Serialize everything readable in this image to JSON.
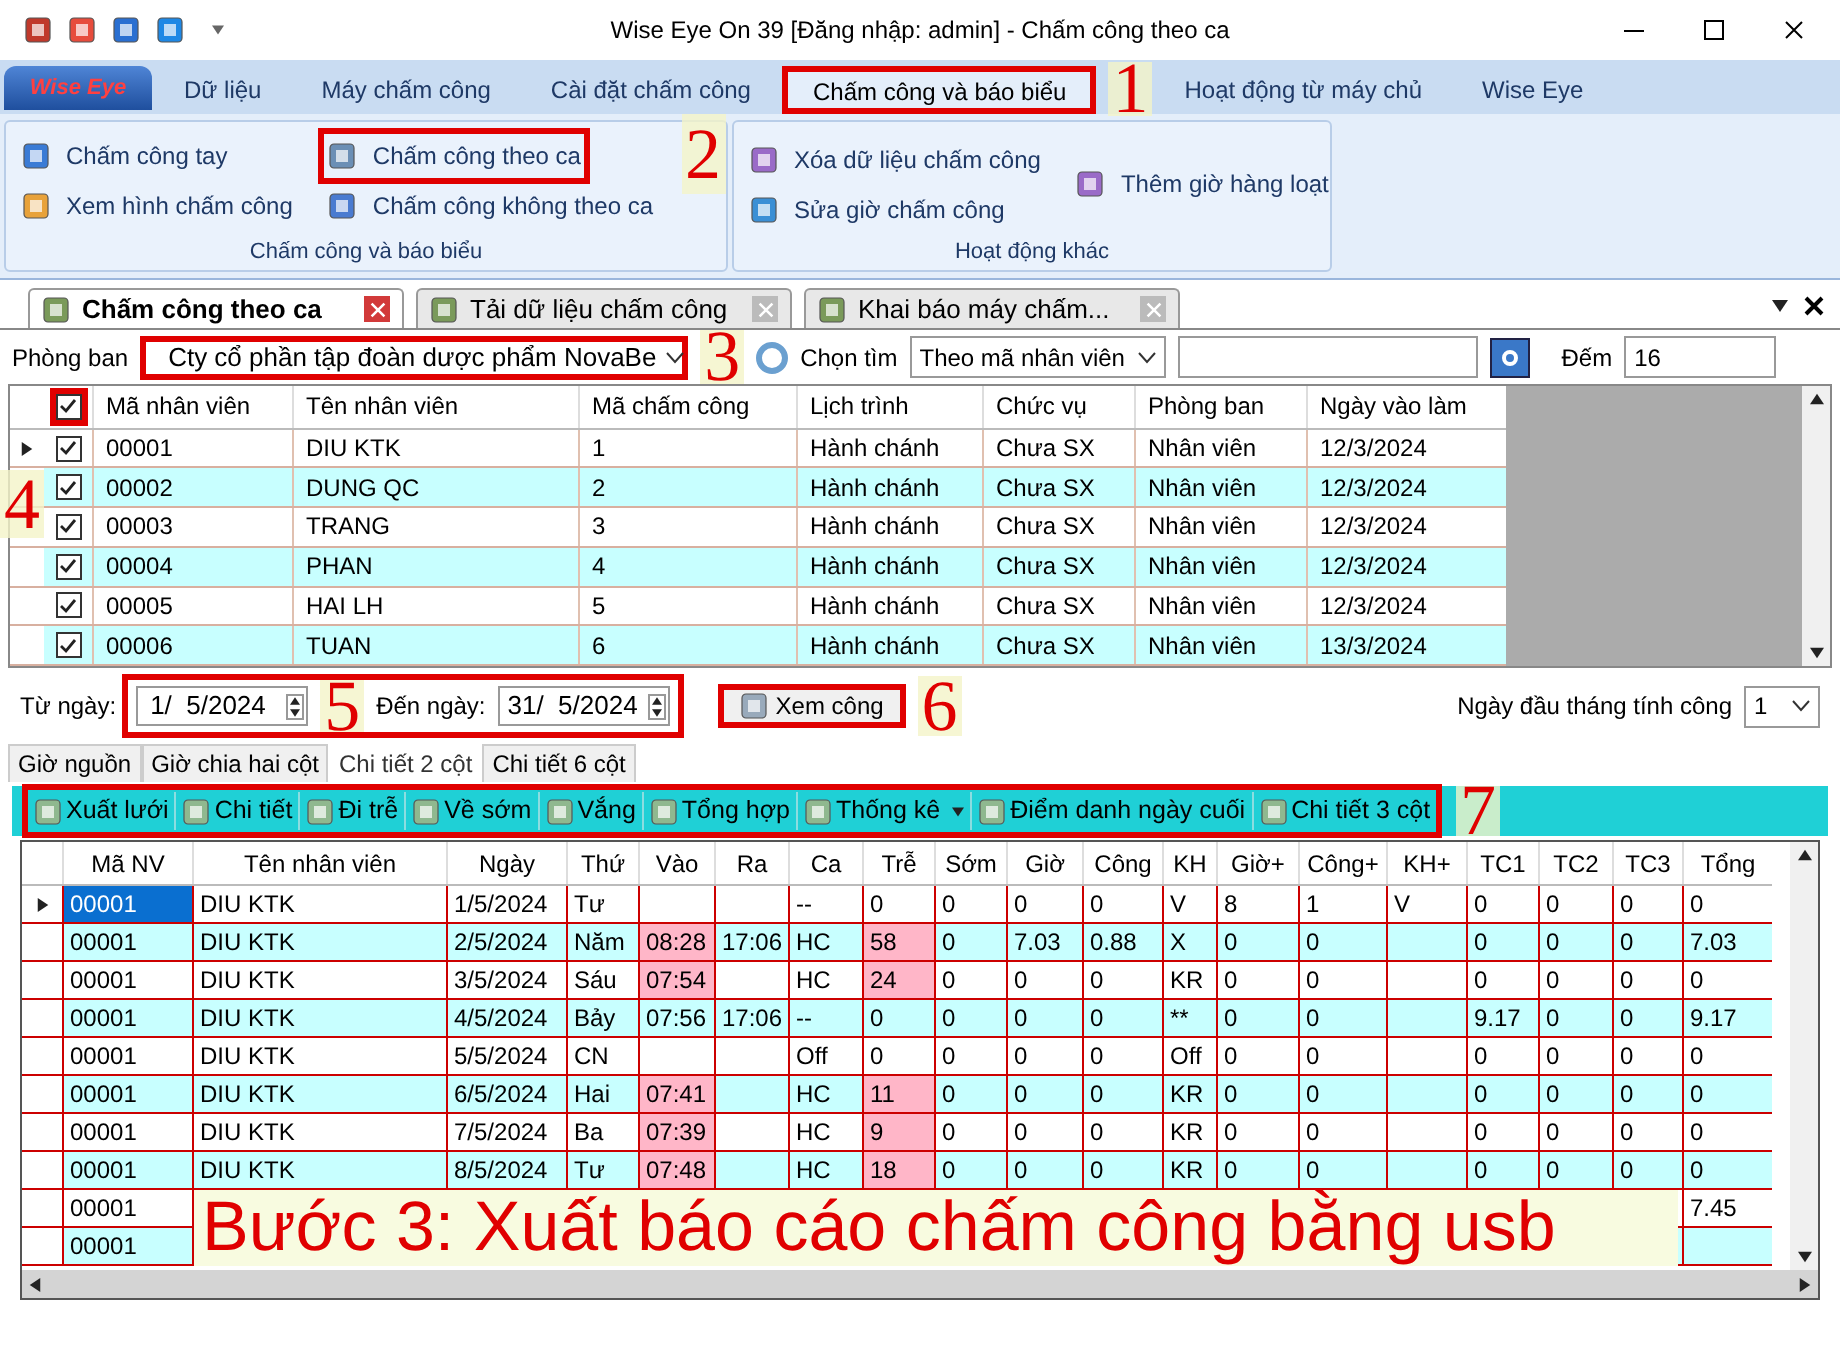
{
  "window": {
    "title": "Wise Eye On 39 [Đăng nhập: admin] - Chấm công theo ca"
  },
  "ribbon": {
    "app_button": "Wise Eye",
    "tabs": [
      {
        "label": "Dữ liệu",
        "selected": false,
        "highlighted": false
      },
      {
        "label": "Máy chấm công",
        "selected": false,
        "highlighted": false
      },
      {
        "label": "Cài đặt chấm công",
        "selected": false,
        "highlighted": false
      },
      {
        "label": "Chấm công và báo biểu",
        "selected": true,
        "highlighted": true,
        "callout": "1"
      },
      {
        "label": "Hoạt động từ máy chủ",
        "selected": false,
        "highlighted": false
      },
      {
        "label": "Wise Eye",
        "selected": false,
        "highlighted": false
      }
    ],
    "groups": [
      {
        "title": "Chấm công và báo biểu",
        "items": [
          {
            "label": "Chấm công tay",
            "highlighted": false
          },
          {
            "label": "Xem hình chấm công",
            "highlighted": false
          },
          {
            "label": "Chấm công theo ca",
            "highlighted": true,
            "callout": "2"
          },
          {
            "label": "Chấm công không theo ca",
            "highlighted": false
          }
        ]
      },
      {
        "title": "Hoạt động khác",
        "items": [
          {
            "label": "Xóa dữ liệu chấm công",
            "highlighted": false
          },
          {
            "label": "Sửa giờ chấm công",
            "highlighted": false
          },
          {
            "label": "Thêm giờ hàng loạt",
            "highlighted": false
          }
        ]
      }
    ]
  },
  "doc_tabs": [
    {
      "label": "Chấm công theo ca",
      "selected": true
    },
    {
      "label": "Tải dữ liệu chấm công",
      "selected": false
    },
    {
      "label": "Khai báo máy chấm...",
      "selected": false
    }
  ],
  "filter": {
    "department_label": "Phòng ban",
    "department": "Cty cổ phần tập đoàn dược phẩm NovaBe",
    "department_highlighted": true,
    "department_callout": "3",
    "search_label": "Chọn tìm",
    "search_mode": "Theo mã nhân viên",
    "count_label": "Đếm",
    "count": "16"
  },
  "employees": {
    "all_checked": true,
    "header_callout": "4",
    "columns": [
      "Mã nhân viên",
      "Tên nhân viên",
      "Mã chấm công",
      "Lịch trình",
      "Chức vụ",
      "Phòng ban",
      "Ngày vào làm"
    ],
    "rows": [
      {
        "checked": true,
        "current": true,
        "cells": [
          "00001",
          "DIU KTK",
          "1",
          "Hành chánh",
          "Chưa SX",
          "Nhân viên",
          "12/3/2024"
        ]
      },
      {
        "checked": true,
        "current": false,
        "cells": [
          "00002",
          "DUNG QC",
          "2",
          "Hành chánh",
          "Chưa SX",
          "Nhân viên",
          "12/3/2024"
        ]
      },
      {
        "checked": true,
        "current": false,
        "cells": [
          "00003",
          "TRANG",
          "3",
          "Hành chánh",
          "Chưa SX",
          "Nhân viên",
          "12/3/2024"
        ]
      },
      {
        "checked": true,
        "current": false,
        "cells": [
          "00004",
          "PHAN",
          "4",
          "Hành chánh",
          "Chưa SX",
          "Nhân viên",
          "12/3/2024"
        ]
      },
      {
        "checked": true,
        "current": false,
        "cells": [
          "00005",
          "HAI LH",
          "5",
          "Hành chánh",
          "Chưa SX",
          "Nhân viên",
          "12/3/2024"
        ]
      },
      {
        "checked": true,
        "current": false,
        "cells": [
          "00006",
          "TUAN",
          "6",
          "Hành chánh",
          "Chưa SX",
          "Nhân viên",
          "13/3/2024"
        ]
      }
    ]
  },
  "date_range": {
    "from_label": "Từ ngày:",
    "from": "1/  5/2024",
    "to_label": "Đến ngày:",
    "to": "31/  5/2024",
    "callout": "5",
    "view_button": "Xem công",
    "view_callout": "6",
    "month_start_label": "Ngày đầu tháng tính công",
    "month_start": "1"
  },
  "sub_tabs": [
    {
      "label": "Giờ nguồn",
      "selected": false
    },
    {
      "label": "Giờ chia hai cột",
      "selected": false
    },
    {
      "label": "Chi tiết 2 cột",
      "selected": true
    },
    {
      "label": "Chi tiết 6 cột",
      "selected": false
    }
  ],
  "toolbar": {
    "callout": "7",
    "items": [
      {
        "label": "Xuất lưới",
        "kind": "button"
      },
      {
        "label": "Chi tiết",
        "kind": "button"
      },
      {
        "label": "Đi trễ",
        "kind": "button"
      },
      {
        "label": "Về sớm",
        "kind": "button"
      },
      {
        "label": "Vắng",
        "kind": "button"
      },
      {
        "label": "Tổng hợp",
        "kind": "button"
      },
      {
        "label": "Thống kê",
        "kind": "dropdown"
      },
      {
        "label": "Điểm danh ngày cuối",
        "kind": "button"
      },
      {
        "label": "Chi tiết 3 cột",
        "kind": "button"
      }
    ]
  },
  "attendance": {
    "columns": [
      "Mã NV",
      "Tên nhân viên",
      "Ngày",
      "Thứ",
      "Vào",
      "Ra",
      "Ca",
      "Trễ",
      "Sớm",
      "Giờ",
      "Công",
      "KH",
      "Giờ+",
      "Công+",
      "KH+",
      "TC1",
      "TC2",
      "TC3",
      "Tổng"
    ],
    "rows": [
      {
        "current": true,
        "late": false,
        "cells": [
          "00001",
          "DIU KTK",
          "1/5/2024",
          "Tư",
          null,
          null,
          "--",
          "0",
          "0",
          "0",
          "0",
          "V",
          "8",
          "1",
          "V",
          "0",
          "0",
          "0",
          "0"
        ]
      },
      {
        "current": false,
        "late": true,
        "cells": [
          "00001",
          "DIU KTK",
          "2/5/2024",
          "Năm",
          "08:28",
          "17:06",
          "HC",
          "58",
          "0",
          "7.03",
          "0.88",
          "X",
          "0",
          "0",
          null,
          "0",
          "0",
          "0",
          "7.03"
        ]
      },
      {
        "current": false,
        "late": true,
        "cells": [
          "00001",
          "DIU KTK",
          "3/5/2024",
          "Sáu",
          "07:54",
          null,
          "HC",
          "24",
          "0",
          "0",
          "0",
          "KR",
          "0",
          "0",
          null,
          "0",
          "0",
          "0",
          "0"
        ]
      },
      {
        "current": false,
        "late": false,
        "cells": [
          "00001",
          "DIU KTK",
          "4/5/2024",
          "Bảy",
          "07:56",
          "17:06",
          "--",
          "0",
          "0",
          "0",
          "0",
          "**",
          "0",
          "0",
          null,
          "9.17",
          "0",
          "0",
          "9.17"
        ]
      },
      {
        "current": false,
        "late": false,
        "cells": [
          "00001",
          "DIU KTK",
          "5/5/2024",
          "CN",
          null,
          null,
          "Off",
          "0",
          "0",
          "0",
          "0",
          "Off",
          "0",
          "0",
          null,
          "0",
          "0",
          "0",
          "0"
        ]
      },
      {
        "current": false,
        "late": true,
        "cells": [
          "00001",
          "DIU KTK",
          "6/5/2024",
          "Hai",
          "07:41",
          null,
          "HC",
          "11",
          "0",
          "0",
          "0",
          "KR",
          "0",
          "0",
          null,
          "0",
          "0",
          "0",
          "0"
        ]
      },
      {
        "current": false,
        "late": true,
        "cells": [
          "00001",
          "DIU KTK",
          "7/5/2024",
          "Ba",
          "07:39",
          null,
          "HC",
          "9",
          "0",
          "0",
          "0",
          "KR",
          "0",
          "0",
          null,
          "0",
          "0",
          "0",
          "0"
        ]
      },
      {
        "current": false,
        "late": true,
        "cells": [
          "00001",
          "DIU KTK",
          "8/5/2024",
          "Tư",
          "07:48",
          null,
          "HC",
          "18",
          "0",
          "0",
          "0",
          "KR",
          "0",
          "0",
          null,
          "0",
          "0",
          "0",
          "0"
        ]
      },
      {
        "current": false,
        "late": false,
        "cells": [
          "00001",
          null,
          null,
          null,
          null,
          null,
          null,
          null,
          null,
          null,
          null,
          null,
          null,
          null,
          null,
          null,
          null,
          null,
          "7.45"
        ]
      },
      {
        "current": false,
        "late": false,
        "cells": [
          "00001",
          null,
          null,
          null,
          null,
          null,
          null,
          null,
          null,
          null,
          null,
          null,
          null,
          null,
          null,
          null,
          null,
          null,
          null
        ]
      }
    ]
  },
  "caption": "Bước 3: Xuất báo cáo chấm công bằng usb"
}
